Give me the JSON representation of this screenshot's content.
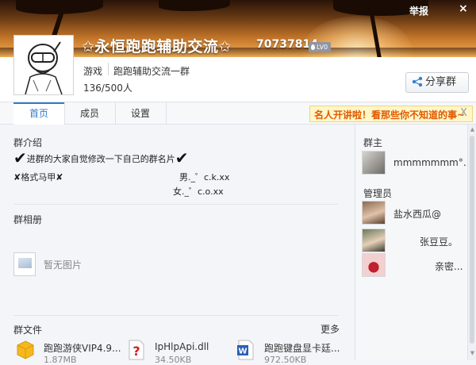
{
  "header": {
    "report_label": "举报",
    "close_label": "×",
    "group_name": "✩永恒跑跑辅助交流✩",
    "group_id": "70737814",
    "level_label": "LV0",
    "tags": [
      "游戏",
      "跑跑辅助交流一群"
    ],
    "members_count": "136/500人",
    "share_label": "分享群"
  },
  "tabs": [
    {
      "label": "首页",
      "active": true
    },
    {
      "label": "成员",
      "active": false
    },
    {
      "label": "设置",
      "active": false
    }
  ],
  "notice": {
    "text": "名人开讲啦！看那些你不知道的事~",
    "close_label": "X"
  },
  "main": {
    "intro_title": "群介绍",
    "intro_line1": "进群的大家自觉修改一下自己的群名片",
    "intro_line2": "格式马甲",
    "intro_male": "男._゜c.k.xx",
    "intro_female": "女._゜c.o.xx",
    "album_title": "群相册",
    "album_empty": "暂无图片",
    "files_title": "群文件",
    "files_more": "更多",
    "files": [
      {
        "name": "跑跑游侠VIP4.9...",
        "size": "1.87MB",
        "icon": "zip-file-icon"
      },
      {
        "name": "IpHlpApi.dll",
        "size": "34.50KB",
        "icon": "unknown-file-icon"
      },
      {
        "name": "跑跑键盘显卡廷...",
        "size": "972.50KB",
        "icon": "word-file-icon"
      }
    ]
  },
  "sidebar": {
    "owner_title": "群主",
    "owner": {
      "name": "mmmmmmm°..."
    },
    "admin_title": "管理员",
    "admins": [
      {
        "name": "盐水西瓜@"
      },
      {
        "name": "张豆豆。"
      },
      {
        "name": "亲密..."
      }
    ]
  },
  "colors": {
    "accent": "#2f7cc9",
    "notice_text": "#e05a00",
    "notice_bg": "#fff6c9"
  }
}
